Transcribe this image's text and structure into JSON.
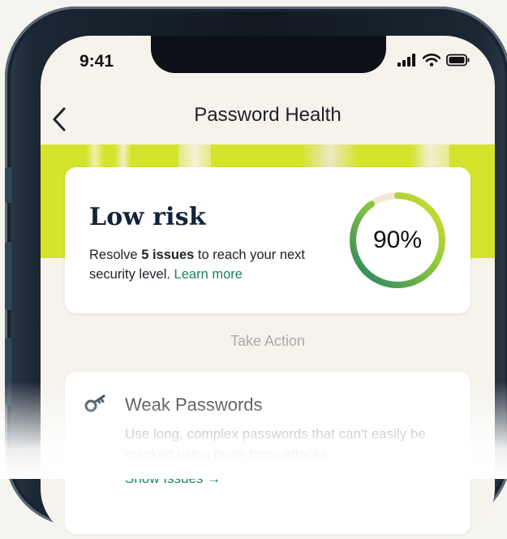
{
  "status": {
    "time": "9:41"
  },
  "nav": {
    "title": "Password Health"
  },
  "summary": {
    "risk_level": "Low risk",
    "desc_prefix": "Resolve ",
    "issues_bold": "5 issues",
    "desc_suffix": " to reach your next security level. ",
    "learn_more": "Learn more",
    "score_label": "90%",
    "score_fraction": 0.9
  },
  "section": {
    "label": "Take Action"
  },
  "weak_passwords": {
    "title": "Weak Passwords",
    "description": "Use long, complex passwords that can't easily be cracked using brute force attacks.",
    "action": "Show Issues →"
  },
  "colors": {
    "accent_green": "#1f7f61",
    "hero_yellow": "#d4e42c",
    "navy": "#12243a"
  }
}
